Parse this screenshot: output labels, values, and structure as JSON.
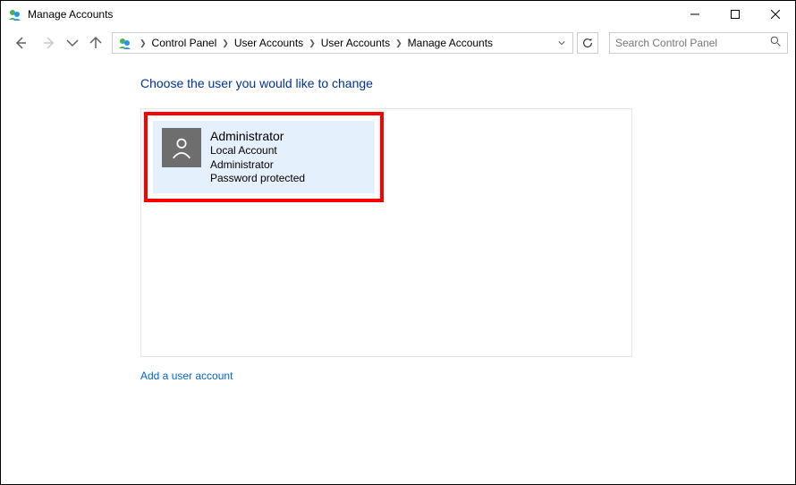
{
  "window": {
    "title": "Manage Accounts"
  },
  "nav": {
    "breadcrumbs": [
      "Control Panel",
      "User Accounts",
      "User Accounts",
      "Manage Accounts"
    ],
    "search_placeholder": "Search Control Panel"
  },
  "page": {
    "heading": "Choose the user you would like to change",
    "accounts": [
      {
        "name": "Administrator",
        "type": "Local Account",
        "role": "Administrator",
        "protection": "Password protected"
      }
    ],
    "add_link": "Add a user account"
  }
}
